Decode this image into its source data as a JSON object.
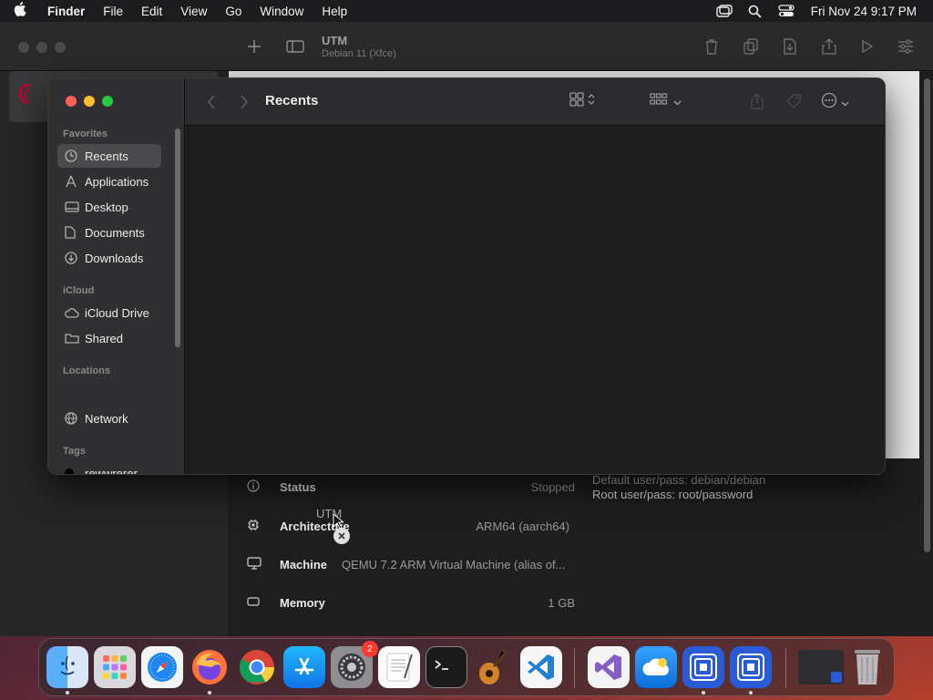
{
  "menubar": {
    "app_name": "Finder",
    "items": [
      "File",
      "Edit",
      "View",
      "Go",
      "Window",
      "Help"
    ],
    "clock": "Fri Nov 24  9:17 PM"
  },
  "utm": {
    "title": "UTM",
    "subtitle": "Debian 11 (Xfce)",
    "status_label": "Status",
    "status_value": "Stopped",
    "notes_line1": "Default user/pass: debian/debian",
    "notes_line2": "Root user/pass: root/password",
    "arch_label": "Architecture",
    "arch_value": "ARM64 (aarch64)",
    "machine_label": "Machine",
    "machine_value": "QEMU 7.2 ARM Virtual Machine (alias of...",
    "memory_label": "Memory",
    "memory_value": "1 GB",
    "drag_label": "UTM"
  },
  "finder": {
    "title": "Recents",
    "sections": {
      "favorites": "Favorites",
      "icloud": "iCloud",
      "locations": "Locations",
      "tags": "Tags"
    },
    "favorites": [
      {
        "label": "Recents",
        "icon": "clock-icon"
      },
      {
        "label": "Applications",
        "icon": "applications-icon"
      },
      {
        "label": "Desktop",
        "icon": "desktop-icon"
      },
      {
        "label": "Documents",
        "icon": "document-icon"
      },
      {
        "label": "Downloads",
        "icon": "download-icon"
      }
    ],
    "icloud": [
      {
        "label": "iCloud Drive",
        "icon": "cloud-icon"
      },
      {
        "label": "Shared",
        "icon": "shared-folder-icon"
      }
    ],
    "locations": [
      {
        "label": "Network",
        "icon": "network-icon"
      }
    ],
    "tags": [
      {
        "label": "rewwrerer",
        "color": "#000000"
      }
    ]
  },
  "dock": {
    "apps": [
      {
        "name": "Finder",
        "running": true
      },
      {
        "name": "Launchpad",
        "running": false
      },
      {
        "name": "Safari",
        "running": false
      },
      {
        "name": "Firefox",
        "running": true
      },
      {
        "name": "Chrome",
        "running": false
      },
      {
        "name": "App Store",
        "running": false
      },
      {
        "name": "System Settings",
        "running": false,
        "badge": "2"
      },
      {
        "name": "TextEdit",
        "running": false
      },
      {
        "name": "Terminal",
        "running": false
      },
      {
        "name": "GarageBand",
        "running": false
      },
      {
        "name": "VS Code",
        "running": false
      },
      {
        "name": "Visual Studio",
        "running": false
      },
      {
        "name": "iCloud",
        "running": false
      },
      {
        "name": "UTM",
        "running": true
      },
      {
        "name": "UTM Helper",
        "running": true
      }
    ]
  },
  "colors": {
    "close": "#ff5f57",
    "minimize": "#febc2e",
    "zoom": "#28c840",
    "accent": "#0a84ff"
  }
}
